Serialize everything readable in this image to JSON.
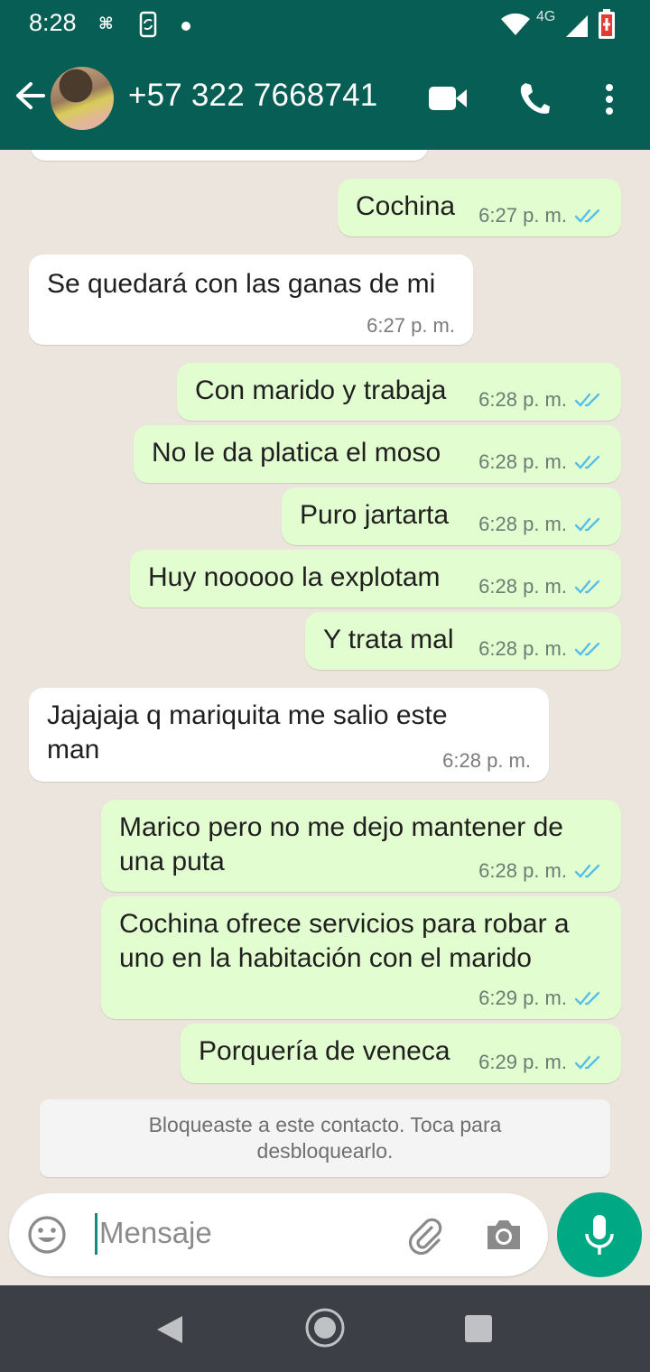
{
  "status_bar": {
    "time": "8:28",
    "network": "4G"
  },
  "header": {
    "contact": "+57 322 7668741"
  },
  "messages": [
    {
      "dir": "out",
      "text": "Cochina",
      "time": "6:27 p. m."
    },
    {
      "dir": "in",
      "text": "Se quedará con las ganas de mi",
      "time": "6:27 p. m."
    },
    {
      "dir": "out",
      "text": "Con marido y trabaja",
      "time": "6:28 p. m."
    },
    {
      "dir": "out",
      "text": "No le da platica el moso",
      "time": "6:28 p. m."
    },
    {
      "dir": "out",
      "text": "Puro jartarta",
      "time": "6:28 p. m."
    },
    {
      "dir": "out",
      "text": "Huy nooooo la explotam",
      "time": "6:28 p. m."
    },
    {
      "dir": "out",
      "text": "Y trata mal",
      "time": "6:28 p. m."
    },
    {
      "dir": "in",
      "text_lines": [
        "Jajajaja q mariquita me salio este",
        "man"
      ],
      "time": "6:28 p. m."
    },
    {
      "dir": "out",
      "text_lines": [
        "Marico pero no me dejo mantener de",
        "una puta"
      ],
      "time": "6:28 p. m."
    },
    {
      "dir": "out",
      "text_lines": [
        "Cochina ofrece servicios para robar a",
        "uno en la habitación con el marido"
      ],
      "time": "6:29 p. m."
    },
    {
      "dir": "out",
      "text": "Porquería de veneca",
      "time": "6:29 p. m."
    }
  ],
  "notice": {
    "line1": "Bloqueaste a este contacto. Toca para",
    "line2": "desbloquearlo."
  },
  "composer": {
    "placeholder": "Mensaje"
  },
  "icons": {
    "back": "arrow-left-icon",
    "video": "video-call-icon",
    "call": "phone-icon",
    "menu": "more-vert-icon",
    "emoji": "emoji-icon",
    "attach": "paperclip-icon",
    "camera": "camera-icon",
    "mic": "mic-icon",
    "read": "double-check-icon"
  },
  "colors": {
    "header": "#075e54",
    "outgoing": "#e2fdcf",
    "incoming": "#ffffff",
    "accent": "#00a884",
    "read_tick": "#53bdeb"
  }
}
